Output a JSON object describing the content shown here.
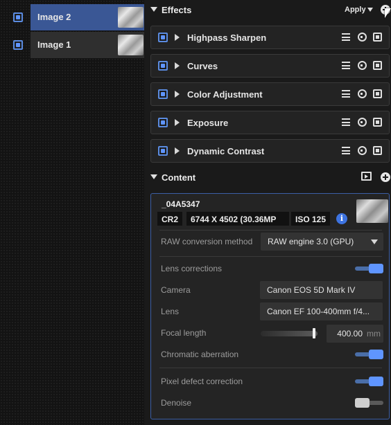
{
  "layers": [
    {
      "name": "Image 2",
      "selected": true
    },
    {
      "name": "Image 1",
      "selected": false
    }
  ],
  "effects": {
    "title": "Effects",
    "apply_label": "Apply",
    "items": [
      {
        "name": "Highpass Sharpen"
      },
      {
        "name": "Curves"
      },
      {
        "name": "Color Adjustment"
      },
      {
        "name": "Exposure"
      },
      {
        "name": "Dynamic Contrast"
      }
    ]
  },
  "content": {
    "title": "Content",
    "file_name": "_04A5347",
    "format": "CR2",
    "dimensions": "6744 X 4502 (30.36MP",
    "iso": "ISO 125",
    "info_glyph": "i",
    "raw_conversion": {
      "label": "RAW conversion method",
      "value": "RAW engine 3.0 (GPU)"
    },
    "lens_corrections": {
      "label": "Lens corrections",
      "enabled": true
    },
    "camera": {
      "label": "Camera",
      "value": "Canon EOS 5D Mark IV"
    },
    "lens": {
      "label": "Lens",
      "value": "Canon EF 100-400mm f/4..."
    },
    "focal_length": {
      "label": "Focal length",
      "value": "400.00",
      "unit": "mm",
      "slider_fraction": 0.96
    },
    "chromatic_aberration": {
      "label": "Chromatic aberration",
      "enabled": true
    },
    "pixel_defect": {
      "label": "Pixel defect correction",
      "enabled": true
    },
    "denoise": {
      "label": "Denoise",
      "enabled": false
    }
  },
  "colors": {
    "accent": "#5f95ff",
    "selected_layer": "#3a5795",
    "card_border": "#3c5fa6",
    "info_icon": "#3d73e0"
  }
}
